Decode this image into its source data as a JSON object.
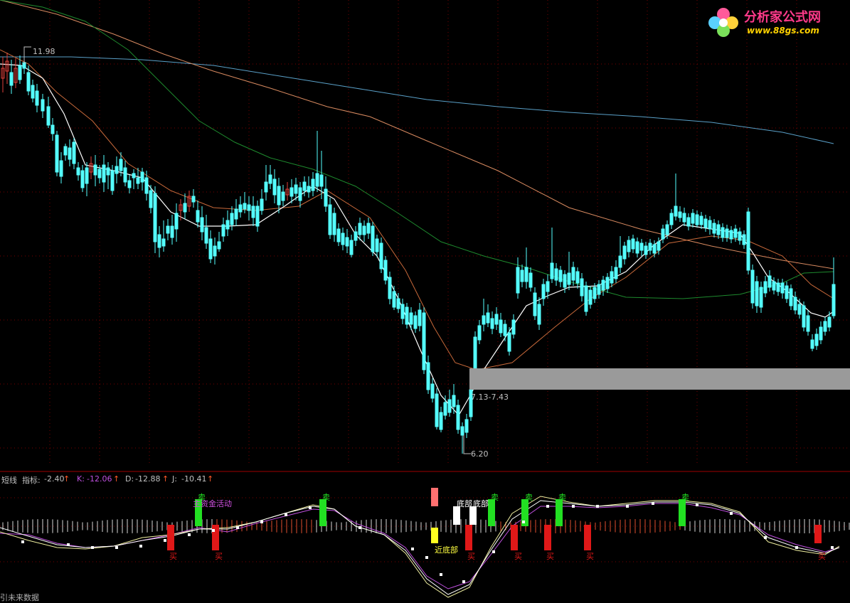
{
  "logo": {
    "title": "分析家公式网",
    "url": "www.88gs.com"
  },
  "price_labels": {
    "high": "11.98",
    "low": "6.20",
    "range": "7.13-7.43"
  },
  "indicator": {
    "name": "短线",
    "label": "指标:",
    "value": "-2.40",
    "k_label": "K:",
    "k_value": "-12.06",
    "d_label": "D:",
    "d_value": "-12.88",
    "j_label": "J:",
    "j_value": "-10.41",
    "arrow": "↑"
  },
  "signals": {
    "sell": "卖",
    "buy": "买",
    "bottom": "底部",
    "near_bottom": "近底部",
    "capital": "主资金活动"
  },
  "footer": "引未来数据",
  "colors": {
    "up_candle": "#e0413a",
    "down_candle": "#54ffff",
    "ma_white": "#ffffff",
    "ma_orange": "#c8693a",
    "ma_peach": "#d88a60",
    "ma_green": "#1e8a2e",
    "ma_blue": "#5aa0c8",
    "grid": "#7a0000",
    "sell_bar": "#22e022",
    "buy_bar": "#e01818"
  }
}
